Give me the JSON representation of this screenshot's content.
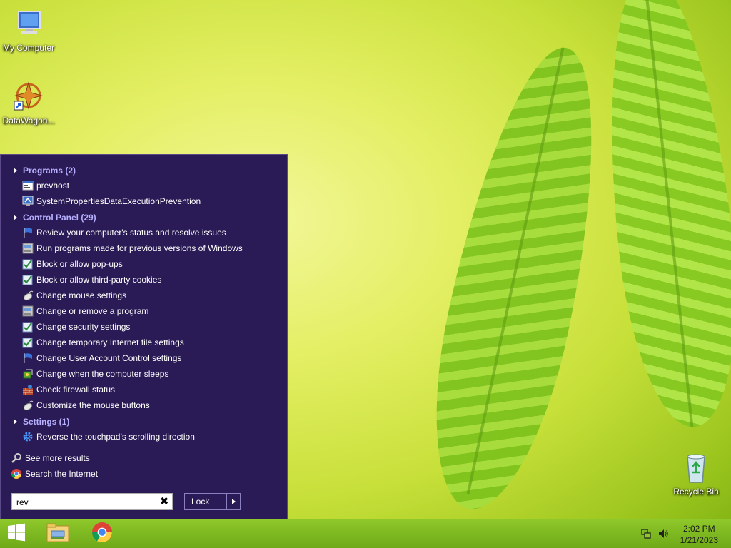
{
  "desktop": {
    "icons": [
      {
        "label": "My Computer",
        "icon": "computer-icon"
      },
      {
        "label": "DataWagon...",
        "icon": "datawagon-shortcut-icon"
      },
      {
        "label": "Recycle Bin",
        "icon": "recycle-bin-icon"
      }
    ]
  },
  "start_menu": {
    "groups": [
      {
        "header": "Programs (2)",
        "items": [
          {
            "label": "prevhost",
            "icon": "window-app-icon"
          },
          {
            "label": "SystemPropertiesDataExecutionPrevention",
            "icon": "system-properties-icon"
          }
        ]
      },
      {
        "header": "Control Panel (29)",
        "items": [
          {
            "label": "Review your computer's status and resolve issues",
            "icon": "flag-icon"
          },
          {
            "label": "Run programs made for previous versions of Windows",
            "icon": "compatibility-icon"
          },
          {
            "label": "Block or allow pop-ups",
            "icon": "internet-options-icon"
          },
          {
            "label": "Block or allow third-party cookies",
            "icon": "internet-options-icon"
          },
          {
            "label": "Change mouse settings",
            "icon": "mouse-icon"
          },
          {
            "label": "Change or remove a program",
            "icon": "programs-icon"
          },
          {
            "label": "Change security settings",
            "icon": "internet-options-icon"
          },
          {
            "label": "Change temporary Internet file settings",
            "icon": "internet-options-icon"
          },
          {
            "label": "Change User Account Control settings",
            "icon": "flag-icon"
          },
          {
            "label": "Change when the computer sleeps",
            "icon": "power-icon"
          },
          {
            "label": "Check firewall status",
            "icon": "firewall-icon"
          },
          {
            "label": "Customize the mouse buttons",
            "icon": "mouse-icon"
          }
        ]
      },
      {
        "header": "Settings (1)",
        "items": [
          {
            "label": "Reverse the touchpad’s scrolling direction",
            "icon": "gear-icon"
          }
        ]
      }
    ],
    "see_more": "See more results",
    "search_internet": "Search the Internet",
    "search_value": "rev",
    "lock_label": "Lock"
  },
  "taskbar": {
    "apps": [
      "windows-start-icon",
      "file-explorer-icon",
      "chrome-icon"
    ],
    "time": "2:02 PM",
    "date": "1/21/2023"
  }
}
